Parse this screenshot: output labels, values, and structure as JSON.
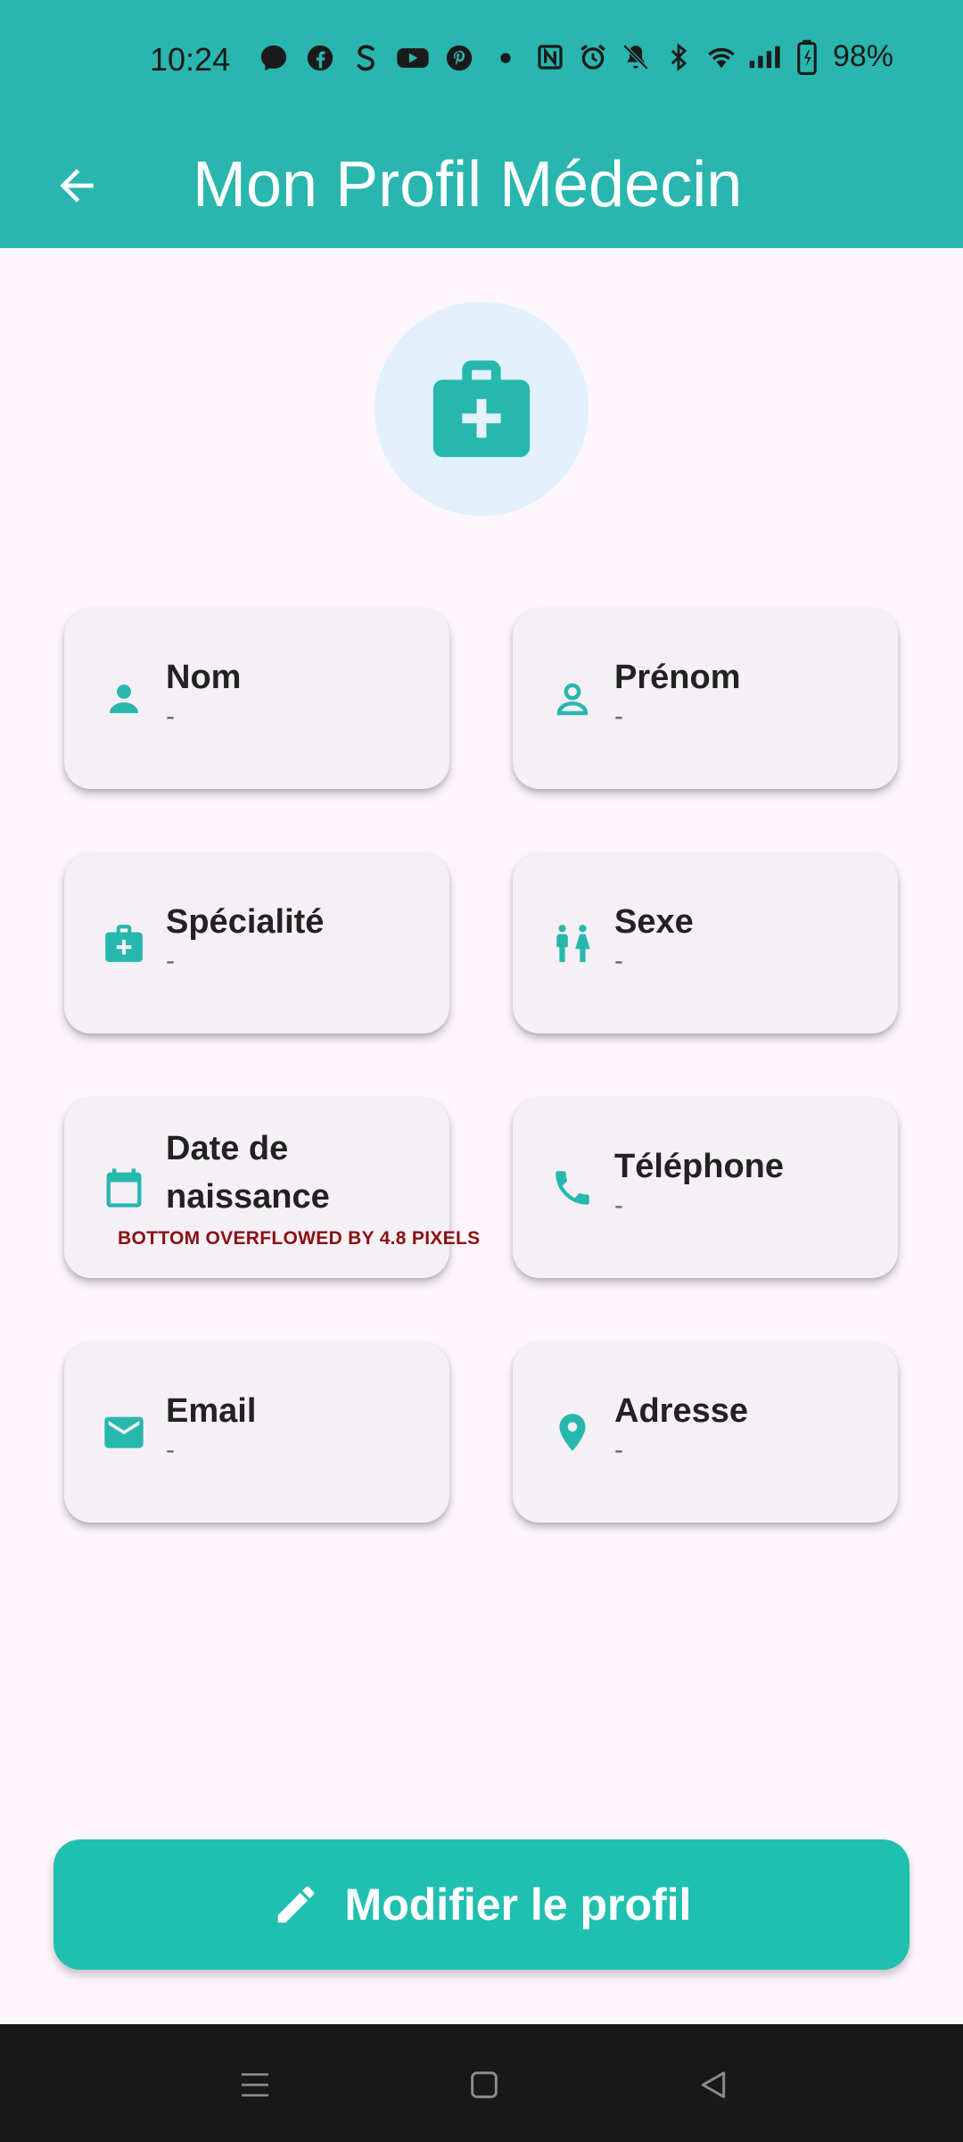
{
  "status_bar": {
    "time": "10:24",
    "battery": "98%",
    "left_icons": [
      "messenger-icon",
      "facebook-icon",
      "s-app-icon",
      "youtube-icon",
      "pinterest-icon",
      "dot-icon"
    ],
    "right_icons": [
      "nfc-icon",
      "alarm-icon",
      "mute-icon",
      "bluetooth-icon",
      "wifi-icon",
      "signal-icon",
      "battery-icon"
    ]
  },
  "app_bar": {
    "title": "Mon Profil Médecin",
    "back_icon": "arrow-back-icon"
  },
  "avatar": {
    "icon": "medical-bag-icon"
  },
  "fields": [
    {
      "label": "Nom",
      "value": "-",
      "icon": "person-icon"
    },
    {
      "label": "Prénom",
      "value": "-",
      "icon": "person-outline-icon"
    },
    {
      "label": "Spécialité",
      "value": "-",
      "icon": "medical-bag-icon"
    },
    {
      "label": "Sexe",
      "value": "-",
      "icon": "wc-icon"
    },
    {
      "label": "Date de naissance",
      "value": "",
      "icon": "calendar-icon"
    },
    {
      "label": "Téléphone",
      "value": "-",
      "icon": "phone-icon"
    },
    {
      "label": "Email",
      "value": "-",
      "icon": "email-icon"
    },
    {
      "label": "Adresse",
      "value": "-",
      "icon": "location-pin-icon"
    }
  ],
  "overflow_warning": "BOTTOM OVERFLOWED BY 4.8 PIXELS",
  "edit_button": {
    "label": "Modifier le profil",
    "icon": "edit-pencil-icon"
  },
  "nav_bar": {
    "icons": [
      "menu-icon",
      "home-square-icon",
      "back-triangle-icon"
    ]
  },
  "colors": {
    "primary": "#29B6AE",
    "accent": "#20C0B0",
    "background": "#FDF7FD",
    "card": "#F5EFF6",
    "error_text": "#8B1010"
  }
}
